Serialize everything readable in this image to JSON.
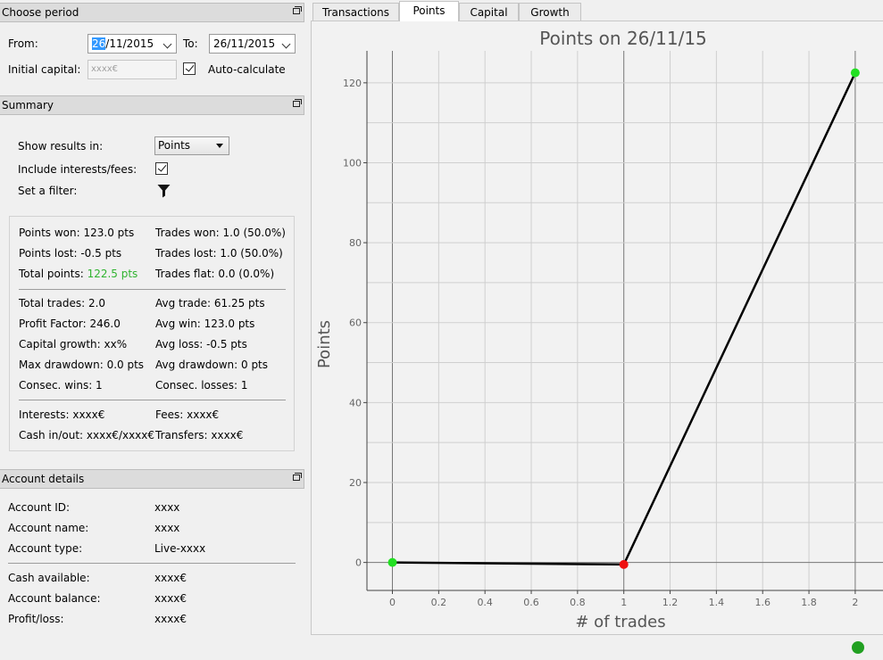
{
  "choose_period": {
    "title": "Choose period",
    "from_label": "From:",
    "from_value_highlight": "26",
    "from_value_rest": "/11/2015",
    "to_label": "To:",
    "to_value": "26/11/2015",
    "initial_capital_label": "Initial capital:",
    "initial_capital_placeholder": "xxxx€",
    "auto_calculate_label": "Auto-calculate",
    "auto_calculate_checked": true
  },
  "summary": {
    "title": "Summary",
    "show_results_label": "Show results in:",
    "show_results_value": "Points",
    "include_interests_label": "Include interests/fees:",
    "include_interests_checked": true,
    "set_filter_label": "Set a filter:",
    "points_won": "Points won: 123.0 pts",
    "points_lost": "Points lost: -0.5 pts",
    "total_points_label": "Total points: ",
    "total_points_value": "122.5 pts",
    "trades_won": "Trades won: 1.0 (50.0%)",
    "trades_lost": "Trades lost: 1.0 (50.0%)",
    "trades_flat": "Trades flat: 0.0 (0.0%)",
    "total_trades": "Total trades: 2.0",
    "profit_factor": "Profit Factor: 246.0",
    "capital_growth": "Capital growth: xx%",
    "max_drawdown": "Max drawdown: 0.0 pts",
    "consec_wins": "Consec. wins: 1",
    "avg_trade": "Avg trade: 61.25 pts",
    "avg_win": "Avg win: 123.0 pts",
    "avg_loss": "Avg loss: -0.5 pts",
    "avg_drawdown": "Avg drawdown: 0 pts",
    "consec_losses": "Consec. losses: 1",
    "interests": "Interests: xxxx€",
    "cash_in_out": "Cash in/out: xxxx€/xxxx€",
    "fees": "Fees: xxxx€",
    "transfers": "Transfers: xxxx€"
  },
  "account_details": {
    "title": "Account details",
    "rows_top": [
      {
        "label": "Account ID:",
        "value": "xxxx"
      },
      {
        "label": "Account name:",
        "value": "xxxx"
      },
      {
        "label": "Account type:",
        "value": "Live-xxxx"
      }
    ],
    "rows_bottom": [
      {
        "label": "Cash available:",
        "value": "xxxx€"
      },
      {
        "label": "Account balance:",
        "value": "xxxx€"
      },
      {
        "label": "Profit/loss:",
        "value": "xxxx€"
      }
    ]
  },
  "tabs": [
    {
      "label": "Transactions",
      "active": false
    },
    {
      "label": "Points",
      "active": true
    },
    {
      "label": "Capital",
      "active": false
    },
    {
      "label": "Growth",
      "active": false
    }
  ],
  "status": {
    "indicator_color": "#22a022"
  },
  "colors": {
    "accent_green": "#2fb32f",
    "point_green": "#22e022",
    "point_red": "#ee1111",
    "line": "#000000"
  },
  "chart_data": {
    "type": "line",
    "title": "Points on 26/11/15",
    "xlabel": "# of trades",
    "ylabel": "Points",
    "xlim": [
      -0.11,
      2.12
    ],
    "ylim": [
      -7,
      128
    ],
    "xticks": [
      0,
      0.2,
      0.4,
      0.6,
      0.8,
      1,
      1.2,
      1.4,
      1.6,
      1.8,
      2
    ],
    "yticks": [
      0,
      20,
      40,
      60,
      80,
      100,
      120
    ],
    "grid": true,
    "series": [
      {
        "x": [
          0,
          1,
          2
        ],
        "y": [
          0,
          -0.5,
          122.5
        ],
        "point_colors": [
          "#22e022",
          "#ee1111",
          "#22e022"
        ]
      }
    ]
  }
}
